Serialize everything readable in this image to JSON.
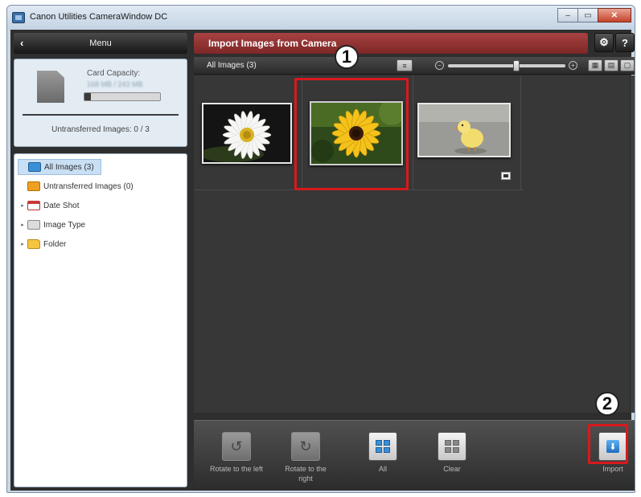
{
  "window": {
    "title": "Canon Utilities CameraWindow DC",
    "minimize": "–",
    "maximize": "▭",
    "close": "✕"
  },
  "left_panel": {
    "menu_back": "‹",
    "menu_label": "Menu",
    "card": {
      "capacity_label": "Card Capacity:",
      "capacity_value": "168 MB / 243 MB",
      "capacity_fraction": 0.08,
      "untransferred": "Untransferred Images: 0 / 3"
    },
    "tree": [
      {
        "label": "All Images (3)",
        "icon": "all-images-icon",
        "expander": ""
      },
      {
        "label": "Untransferred Images (0)",
        "icon": "untransferred-icon",
        "expander": ""
      },
      {
        "label": "Date Shot",
        "icon": "calendar-icon",
        "expander": "▸"
      },
      {
        "label": "Image Type",
        "icon": "image-type-icon",
        "expander": "▸"
      },
      {
        "label": "Folder",
        "icon": "folder-icon",
        "expander": "▸"
      }
    ]
  },
  "header": {
    "title": "Import Images from Camera",
    "settings_icon": "⚙",
    "help_icon": "?"
  },
  "image_bar": {
    "label": "All Images (3)",
    "sort_icon": "≡",
    "zoom_min": "−",
    "zoom_max": "+",
    "zoom_level": 0.58,
    "view_thumbs": "▦",
    "view_list": "▤",
    "view_full": "▢"
  },
  "images": [
    {
      "name": "daisy",
      "selected": false,
      "movie": false
    },
    {
      "name": "sunflower",
      "selected": true,
      "movie": false
    },
    {
      "name": "chick",
      "selected": false,
      "movie": true
    }
  ],
  "callouts": {
    "step1": "1",
    "step2": "2"
  },
  "toolbar": {
    "rotate_left": "Rotate to the left",
    "rotate_right": "Rotate to the right",
    "all": "All",
    "clear": "Clear",
    "import": "Import"
  },
  "colors": {
    "header_red": "#a84242",
    "highlight_red": "#d8191c",
    "selected_blue": "#3b8fd6"
  }
}
